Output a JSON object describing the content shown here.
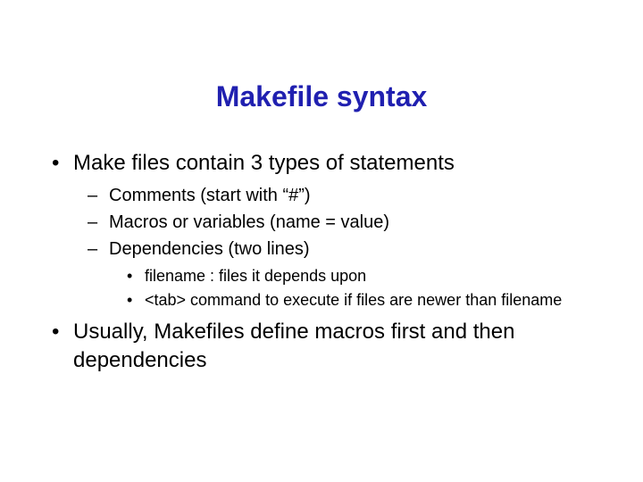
{
  "title": "Makefile syntax",
  "bullets": {
    "b0": "Make files contain 3 types of statements",
    "b0_0": "Comments (start with “#”)",
    "b0_1": "Macros or variables (name = value)",
    "b0_2": "Dependencies (two lines)",
    "b0_2_0": "filename : files it depends upon",
    "b0_2_1": "<tab>   command to execute if files are newer than filename",
    "b1": "Usually, Makefiles define macros first and then dependencies"
  }
}
